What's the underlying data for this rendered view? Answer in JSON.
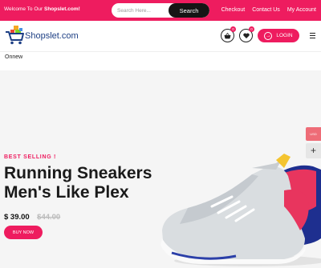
{
  "topbar": {
    "welcome_prefix": "Welcome To Our ",
    "welcome_brand": "Shopslet.com!",
    "search_placeholder": "Search Here...",
    "search_label": "Search",
    "links": [
      "Checkout",
      "Contact Us",
      "My Account"
    ]
  },
  "header": {
    "brand": "Shopslet.com",
    "cart_count": "0",
    "wishlist_count": "0",
    "login_label": "LOGIN"
  },
  "nav": {
    "item": "Onnew"
  },
  "hero": {
    "eyebrow": "BEST SELLING !",
    "headline_line1": "Running Sneakers",
    "headline_line2": "Men's Like Plex",
    "price_now": "$ 39.00",
    "price_old": "$44.00",
    "buy_label": "BUY NOW",
    "side_tab": "USD",
    "side_plus": "+"
  },
  "colors": {
    "accent": "#ee1c5f",
    "dark": "#151515",
    "brand_blue": "#1d3f84",
    "hero_bg": "#f5f5f5"
  }
}
